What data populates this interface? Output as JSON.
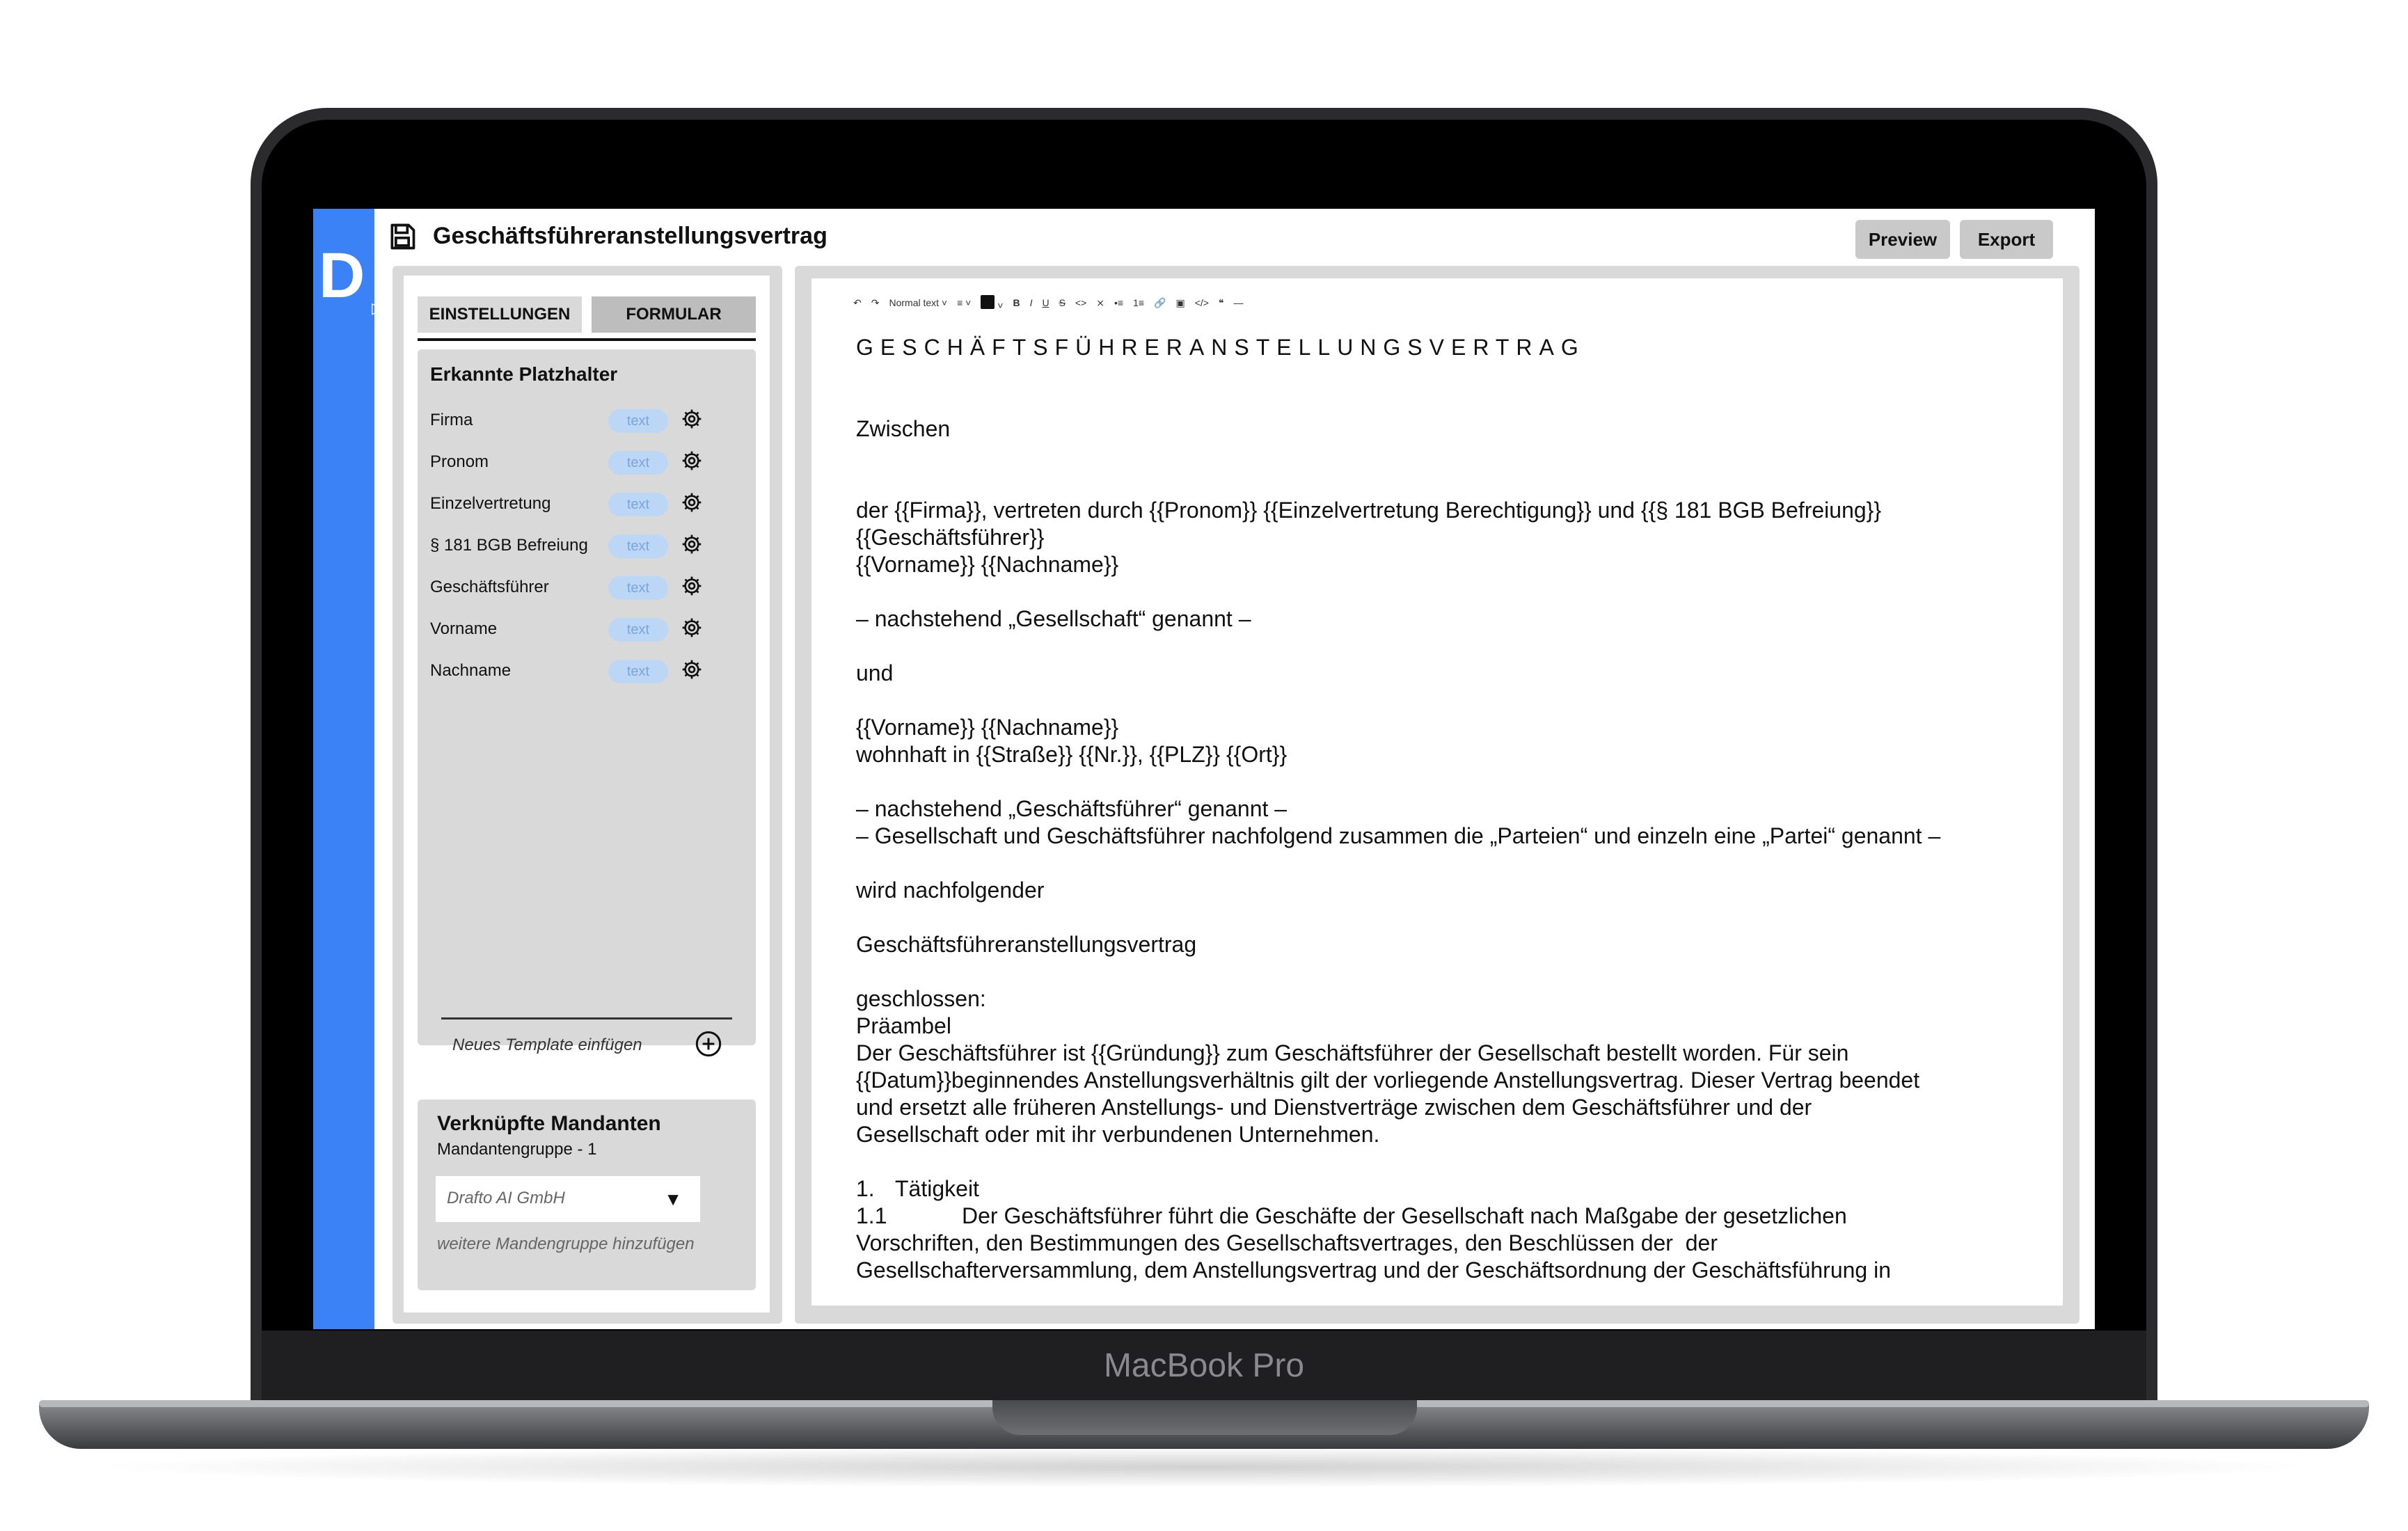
{
  "device": {
    "label": "MacBook Pro"
  },
  "app": {
    "logo": "D",
    "document_title": "Geschäftsführeranstellungsvertrag"
  },
  "header": {
    "preview_label": "Preview",
    "export_label": "Export"
  },
  "sidebar": {
    "tabs": [
      {
        "label": "EINSTELLUNGEN",
        "active": false
      },
      {
        "label": "FORMULAR",
        "active": true
      }
    ],
    "placeholders_title": "Erkannte Platzhalter",
    "placeholders": [
      {
        "name": "Firma",
        "type": "text"
      },
      {
        "name": "Pronom",
        "type": "text"
      },
      {
        "name": "Einzelvertretung",
        "type": "text"
      },
      {
        "name": "§ 181 BGB Befreiung",
        "type": "text"
      },
      {
        "name": "Geschäftsführer",
        "type": "text"
      },
      {
        "name": "Vorname",
        "type": "text"
      },
      {
        "name": "Nachname",
        "type": "text"
      }
    ],
    "new_template_label": "Neues Template einfügen",
    "clients": {
      "title": "Verknüpfte Mandanten",
      "group": "Mandantengruppe - 1",
      "selected": "Drafto AI GmbH",
      "add_label": "weitere Mandengruppe hinzufügen"
    }
  },
  "toolbar": {
    "text_style": "Normal text"
  },
  "document": {
    "heading": "GESCHÄFTSFÜHRERANSTELLUNGSVERTRAG",
    "between": "Zwischen",
    "party1_line1": "der {{Firma}}, vertreten durch {{Pronom}} {{Einzelvertretung Berechtigung}} und {{§ 181 BGB Befreiung}}",
    "party1_line2": "{{Geschäftsführer}}",
    "party1_line3": "{{Vorname}} {{Nachname}}",
    "party1_named": "– nachstehend „Gesellschaft“ genannt –",
    "and": "und",
    "party2_line1": "{{Vorname}} {{Nachname}}",
    "party2_line2": "wohnhaft in {{Straße}} {{Nr.}}, {{PLZ}} {{Ort}}",
    "party2_named": "– nachstehend „Geschäftsführer“ genannt –",
    "parties_named": "– Gesellschaft und Geschäftsführer nachfolgend zusammen die „Parteien“ und einzeln eine „Partei“ genannt –",
    "following": "wird nachfolgender",
    "contract_name": "Geschäftsführeranstellungsvertrag",
    "concluded": "geschlossen:",
    "preamble_title": "Präambel",
    "preamble_l1": "Der Geschäftsführer ist {{Gründung}} zum Geschäftsführer der Gesellschaft bestellt worden. Für sein",
    "preamble_l2": "{{Datum}}beginnendes Anstellungsverhältnis gilt der vorliegende Anstellungsvertrag. Dieser Vertrag beendet",
    "preamble_l3": "und ersetzt alle früheren Anstellungs- und Dienstverträge zwischen dem Geschäftsführer und der",
    "preamble_l4": "Gesellschaft oder mit ihr verbundenen Unternehmen.",
    "sec1_num": "1.",
    "sec1_title": "Tätigkeit",
    "sec11_num": "1.1",
    "sec11_l1": "Der Geschäftsführer führt die Geschäfte der Gesellschaft nach Maßgabe der gesetzlichen",
    "sec11_l2": "Vorschriften, den Bestimmungen des Gesellschaftsvertrages, den Beschlüssen der  der",
    "sec11_l3": "Gesellschafterversammlung, dem Anstellungsvertrag und der Geschäftsordnung der Geschäftsführung in"
  },
  "colors": {
    "accent": "#3b82f6",
    "panel": "#d9d9d9",
    "pill": "#bcd6f5"
  }
}
